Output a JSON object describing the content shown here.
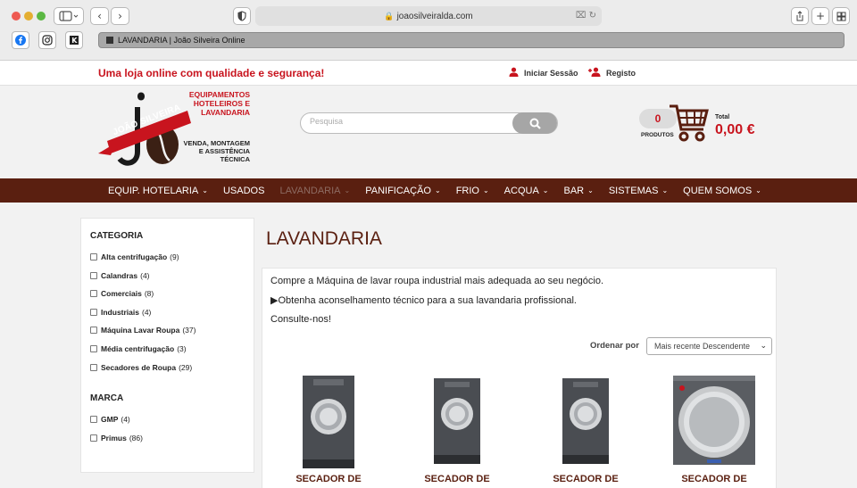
{
  "browser": {
    "url": "joaosilveiralda.com",
    "tab_title": "LAVANDARIA | João Silveira Online",
    "colors": {
      "chrome": "#ececec",
      "tab": "#a8a8a8"
    },
    "icons": [
      "sidebar-icon",
      "back-icon",
      "forward-icon",
      "shield-icon",
      "lock-icon",
      "translate-icon",
      "reload-icon",
      "share-icon",
      "new-tab-icon",
      "tab-overview-icon",
      "facebook-icon",
      "instagram-icon",
      "bookmark-icon"
    ]
  },
  "topbar": {
    "tagline": "Uma loja online com qualidade e segurança!",
    "login": "Iniciar Sessão",
    "register": "Registo"
  },
  "logo": {
    "line1": "EQUIPAMENTOS",
    "line2": "HOTELEIROS E",
    "line3": "LAVANDARIA",
    "ribbon": "JOÃO SILVEIRA",
    "sub1": "VENDA, MONTAGEM",
    "sub2": "E ASSISTÊNCIA",
    "sub3": "TÉCNICA"
  },
  "search": {
    "placeholder": "Pesquisa"
  },
  "cart": {
    "count": "0",
    "count_label": "PRODUTOS",
    "total_label": "Total",
    "total_value": "0,00 €"
  },
  "nav": {
    "items": [
      {
        "label": "EQUIP. HOTELARIA",
        "dropdown": true
      },
      {
        "label": "USADOS",
        "dropdown": false
      },
      {
        "label": "LAVANDARIA",
        "dropdown": true,
        "active": true
      },
      {
        "label": "PANIFICAÇÃO",
        "dropdown": true
      },
      {
        "label": "FRIO",
        "dropdown": true
      },
      {
        "label": "ACQUA",
        "dropdown": true
      },
      {
        "label": "BAR",
        "dropdown": true
      },
      {
        "label": "SISTEMAS",
        "dropdown": true
      },
      {
        "label": "QUEM SOMOS",
        "dropdown": true
      }
    ]
  },
  "sidebar": {
    "category_title": "CATEGORIA",
    "categories": [
      {
        "name": "Alta centrifugação",
        "count": "(9)"
      },
      {
        "name": "Calandras",
        "count": "(4)"
      },
      {
        "name": "Comerciais",
        "count": "(8)"
      },
      {
        "name": "Industriais",
        "count": "(4)"
      },
      {
        "name": "Máquina Lavar Roupa",
        "count": "(37)"
      },
      {
        "name": "Média centrifugação",
        "count": "(3)"
      },
      {
        "name": "Secadores de Roupa",
        "count": "(29)"
      }
    ],
    "brand_title": "MARCA",
    "brands": [
      {
        "name": "GMP",
        "count": "(4)"
      },
      {
        "name": "Primus",
        "count": "(86)"
      }
    ]
  },
  "main": {
    "title": "LAVANDARIA",
    "intro1": "Compre a Máquina de lavar roupa industrial mais adequada ao seu negócio.",
    "intro2": "▶Obtenha aconselhamento técnico para a sua lavandaria profissional.",
    "intro3": "Consulte-nos!",
    "sort_label": "Ordenar por",
    "sort_value": "Mais recente Descendente",
    "products": [
      {
        "name": "SECADOR DE"
      },
      {
        "name": "SECADOR DE"
      },
      {
        "name": "SECADOR DE"
      },
      {
        "name": "SECADOR DE"
      }
    ]
  },
  "colors": {
    "brand_red": "#c8141e",
    "brand_brown": "#5a1f10"
  }
}
